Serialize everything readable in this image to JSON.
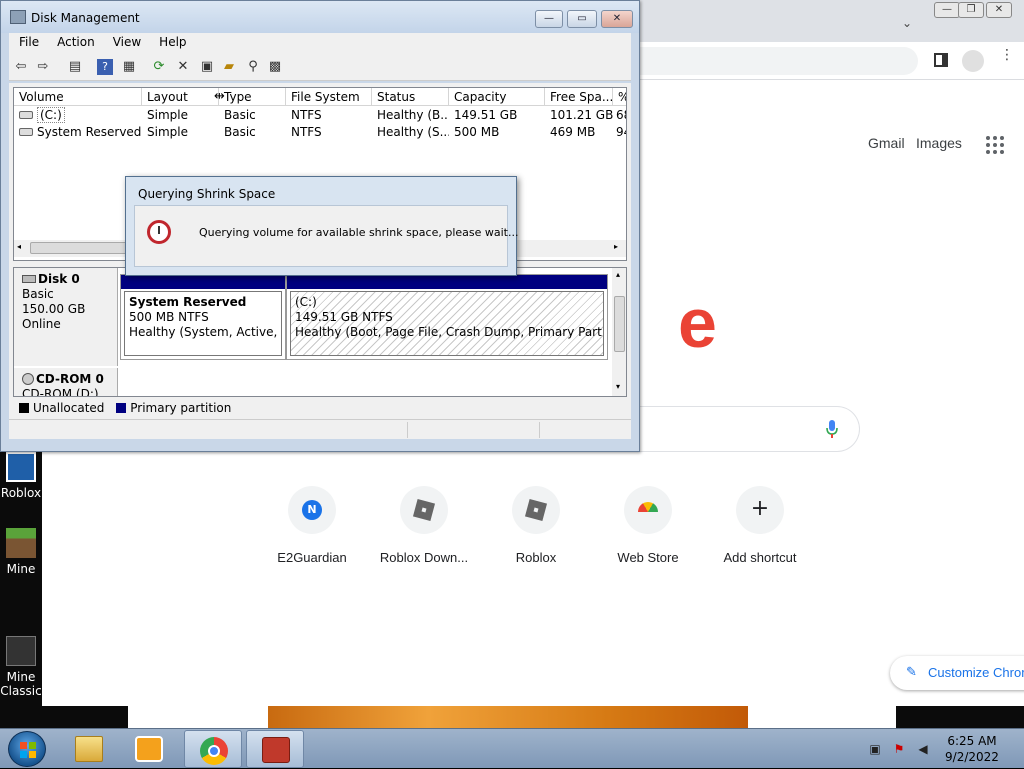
{
  "desktop": {
    "icons": [
      {
        "label": "Roblox"
      },
      {
        "label": "Mine"
      },
      {
        "label": "Mine Classic"
      }
    ]
  },
  "chrome": {
    "links": {
      "gmail": "Gmail",
      "images": "Images"
    },
    "logo_fragment": "e",
    "shortcuts": [
      {
        "label": "E2Guardian",
        "glyph": "N"
      },
      {
        "label": "Roblox Down..."
      },
      {
        "label": "Roblox"
      },
      {
        "label": "Web Store"
      },
      {
        "label": "Add shortcut",
        "glyph": "+"
      }
    ],
    "customize_label": "Customize Chrome"
  },
  "disk_mgmt": {
    "title": "Disk Management",
    "menu": [
      "File",
      "Action",
      "View",
      "Help"
    ],
    "columns": [
      "Volume",
      "Layout",
      "Type",
      "File System",
      "Status",
      "Capacity",
      "Free Spa...",
      "%"
    ],
    "volumes": [
      {
        "volume": "(C:)",
        "layout": "Simple",
        "type": "Basic",
        "fs": "NTFS",
        "status": "Healthy (B...",
        "capacity": "149.51 GB",
        "free": "101.21 GB",
        "pct": "68"
      },
      {
        "volume": "System Reserved",
        "layout": "Simple",
        "type": "Basic",
        "fs": "NTFS",
        "status": "Healthy (S...",
        "capacity": "500 MB",
        "free": "469 MB",
        "pct": "94"
      }
    ],
    "disk0": {
      "name": "Disk 0",
      "type": "Basic",
      "size": "150.00 GB",
      "state": "Online",
      "partitions": [
        {
          "name": "System Reserved",
          "size": "500 MB NTFS",
          "status": "Healthy (System, Active, Prin"
        },
        {
          "name": "(C:)",
          "size": "149.51 GB NTFS",
          "status": "Healthy (Boot, Page File, Crash Dump, Primary Partition)"
        }
      ]
    },
    "cdrom": {
      "name": "CD-ROM 0",
      "sub": "CD-ROM (D:)"
    },
    "legend": {
      "unallocated": "Unallocated",
      "primary": "Primary partition"
    },
    "colors": {
      "primary": "#000080",
      "unallocated": "#000000"
    }
  },
  "modal": {
    "title": "Querying Shrink Space",
    "message": "Querying volume for available shrink space, please wait..."
  },
  "taskbar": {
    "time": "6:25 AM",
    "date": "9/2/2022"
  }
}
